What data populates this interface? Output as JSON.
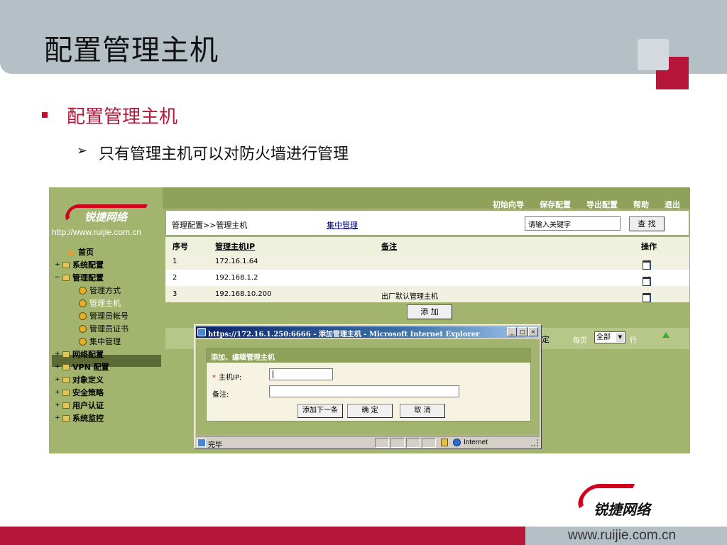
{
  "slide": {
    "title": "配置管理主机",
    "bullet": "配置管理主机",
    "sub_bullet": "只有管理主机可以对防火墙进行管理",
    "sub_bullet_marker": "➢",
    "footer_url": "www.ruijie.com.cn",
    "brand_text": "锐捷网络",
    "accent_color": "#b5163a"
  },
  "app": {
    "logo_text": "锐捷网络",
    "logo_url": "http://www.ruijie.com.cn",
    "top_links": [
      "初始向导",
      "保存配置",
      "导出配置",
      "帮助",
      "退出"
    ],
    "sidebar": [
      {
        "label": "首页",
        "icon": "home-icon",
        "toggle": ""
      },
      {
        "label": "系统配置",
        "icon": "folder-icon",
        "toggle": "+"
      },
      {
        "label": "管理配置",
        "icon": "folder-icon",
        "toggle": "−"
      },
      {
        "label": "管理方式",
        "icon": "leaf-icon",
        "sub": true
      },
      {
        "label": "管理主机",
        "icon": "leaf-icon",
        "sub": true,
        "selected": true
      },
      {
        "label": "管理员帐号",
        "icon": "leaf-icon",
        "sub": true
      },
      {
        "label": "管理员证书",
        "icon": "leaf-icon",
        "sub": true
      },
      {
        "label": "集中管理",
        "icon": "leaf-icon",
        "sub": true
      },
      {
        "label": "网络配置",
        "icon": "folder-icon",
        "toggle": "+"
      },
      {
        "label": "VPN 配置",
        "icon": "folder-icon",
        "toggle": "+"
      },
      {
        "label": "对象定义",
        "icon": "folder-icon",
        "toggle": "+"
      },
      {
        "label": "安全策略",
        "icon": "folder-icon",
        "toggle": "+"
      },
      {
        "label": "用户认证",
        "icon": "folder-icon",
        "toggle": "+"
      },
      {
        "label": "系统监控",
        "icon": "folder-icon",
        "toggle": "+"
      }
    ],
    "breadcrumb": "管理配置>>管理主机",
    "central_link": "集中管理",
    "search": {
      "placeholder": "请输入关键字",
      "value": "请输入关键字",
      "button": "查 找"
    },
    "table": {
      "headers": [
        "序号",
        "管理主机IP",
        "备注",
        "操作"
      ],
      "rows": [
        {
          "index": "1",
          "ip": "172.16.1.64",
          "note": ""
        },
        {
          "index": "2",
          "ip": "192.168.1.2",
          "note": ""
        },
        {
          "index": "3",
          "ip": "192.168.10.200",
          "note": "出厂默认管理主机"
        }
      ]
    },
    "add_button": "添 加",
    "pager": {
      "confirm": "定",
      "per_page_label": "每页",
      "per_page_value": "全部",
      "row_label": "行"
    }
  },
  "popup": {
    "title": "https://172.16.1.250:6666 - 添加管理主机 - Microsoft Internet Explorer",
    "window_buttons": [
      "_",
      "□",
      "×"
    ],
    "form_title": "添加、编辑管理主机",
    "required_mark": "*",
    "host_ip_label": "主机IP:",
    "note_label": "备注:",
    "buttons": {
      "add_next": "添加下一条",
      "confirm": "确 定",
      "cancel": "取 消"
    },
    "status_text": "完毕",
    "zone": "Internet"
  }
}
